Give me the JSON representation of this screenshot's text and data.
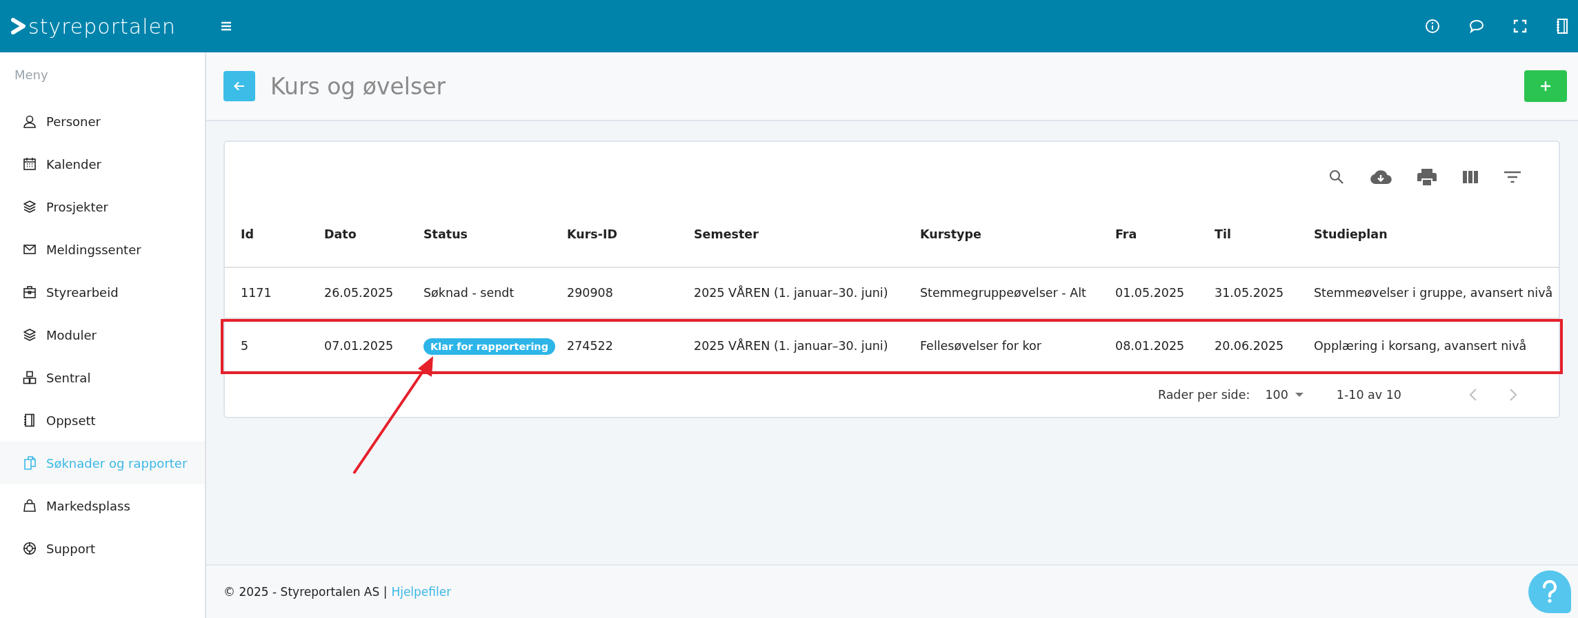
{
  "header": {
    "logo": "styreportalen"
  },
  "sidebar": {
    "heading": "Meny",
    "items": [
      {
        "label": "Personer",
        "selected": false
      },
      {
        "label": "Kalender",
        "selected": false
      },
      {
        "label": "Prosjekter",
        "selected": false
      },
      {
        "label": "Meldingssenter",
        "selected": false
      },
      {
        "label": "Styrearbeid",
        "selected": false
      },
      {
        "label": "Moduler",
        "selected": false
      },
      {
        "label": "Sentral",
        "selected": false
      },
      {
        "label": "Oppsett",
        "selected": false
      },
      {
        "label": "Søknader og rapporter",
        "selected": true
      },
      {
        "label": "Markedsplass",
        "selected": false
      },
      {
        "label": "Support",
        "selected": false
      }
    ]
  },
  "page": {
    "title": "Kurs og øvelser"
  },
  "table": {
    "columns": [
      "Id",
      "Dato",
      "Status",
      "Kurs-ID",
      "Semester",
      "Kurstype",
      "Fra",
      "Til",
      "Studieplan"
    ],
    "rows": [
      {
        "highlighted": false,
        "kind": "text",
        "cells": [
          "1171",
          "26.05.2025",
          "Søknad - sendt",
          "290908",
          "2025 VÅREN (1. januar–30. juni)",
          "Stemmegruppeøvelser - Alt",
          "01.05.2025",
          "31.05.2025",
          "Stemmeøvelser i gruppe, avansert nivå"
        ]
      },
      {
        "highlighted": true,
        "kind": "badge",
        "cells": [
          "5",
          "07.01.2025",
          "Klar for rapportering",
          "274522",
          "2025 VÅREN (1. januar–30. juni)",
          "Fellesøvelser for kor",
          "08.01.2025",
          "20.06.2025",
          "Opplæring i korsang, avansert nivå"
        ]
      }
    ],
    "pagination": {
      "rows_per_page_label": "Rader per side:",
      "rows_per_page": "100",
      "range": "1-10 av 10"
    }
  },
  "footer": {
    "copyright": "© 2025 - Styreportalen AS |",
    "link": "Hjelpefiler"
  }
}
